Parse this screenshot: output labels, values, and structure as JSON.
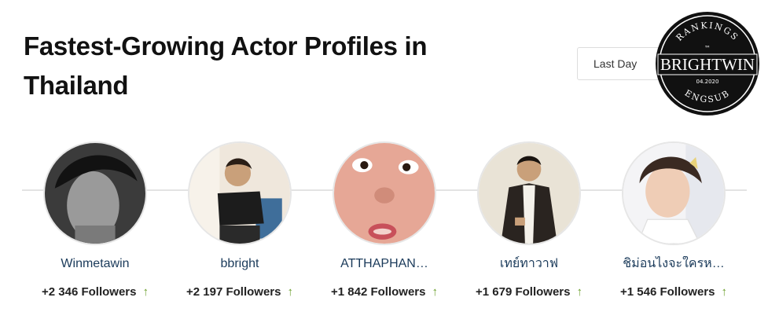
{
  "header": {
    "title": "Fastest-Growing Actor Profiles in Thailand",
    "period_select": "Last Day"
  },
  "badge": {
    "top_text": "RANKINGS",
    "tm": "™",
    "main_text": "BRIGHTWIN",
    "date_text": "04.2020",
    "bottom_text": "ENGSUB"
  },
  "profiles": [
    {
      "name": "Winmetawin",
      "followers": "+2 346 Followers",
      "trend_icon": "up-arrow-icon",
      "arrow": "↑"
    },
    {
      "name": "bbright",
      "followers": "+2 197 Followers",
      "trend_icon": "up-arrow-icon",
      "arrow": "↑"
    },
    {
      "name": "ATTHAPHAN…",
      "followers": "+1 842 Followers",
      "trend_icon": "up-arrow-icon",
      "arrow": "↑"
    },
    {
      "name": "เทย์ทาวาฟ",
      "followers": "+1 679 Followers",
      "trend_icon": "up-arrow-icon",
      "arrow": "↑"
    },
    {
      "name": "ชิม่อนไงจะใครห…",
      "followers": "+1 546 Followers",
      "trend_icon": "up-arrow-icon",
      "arrow": "↑"
    }
  ],
  "colors": {
    "name_link": "#1a3a5a",
    "trend_up": "#6a9f2a",
    "timeline": "#e3e3e3"
  }
}
